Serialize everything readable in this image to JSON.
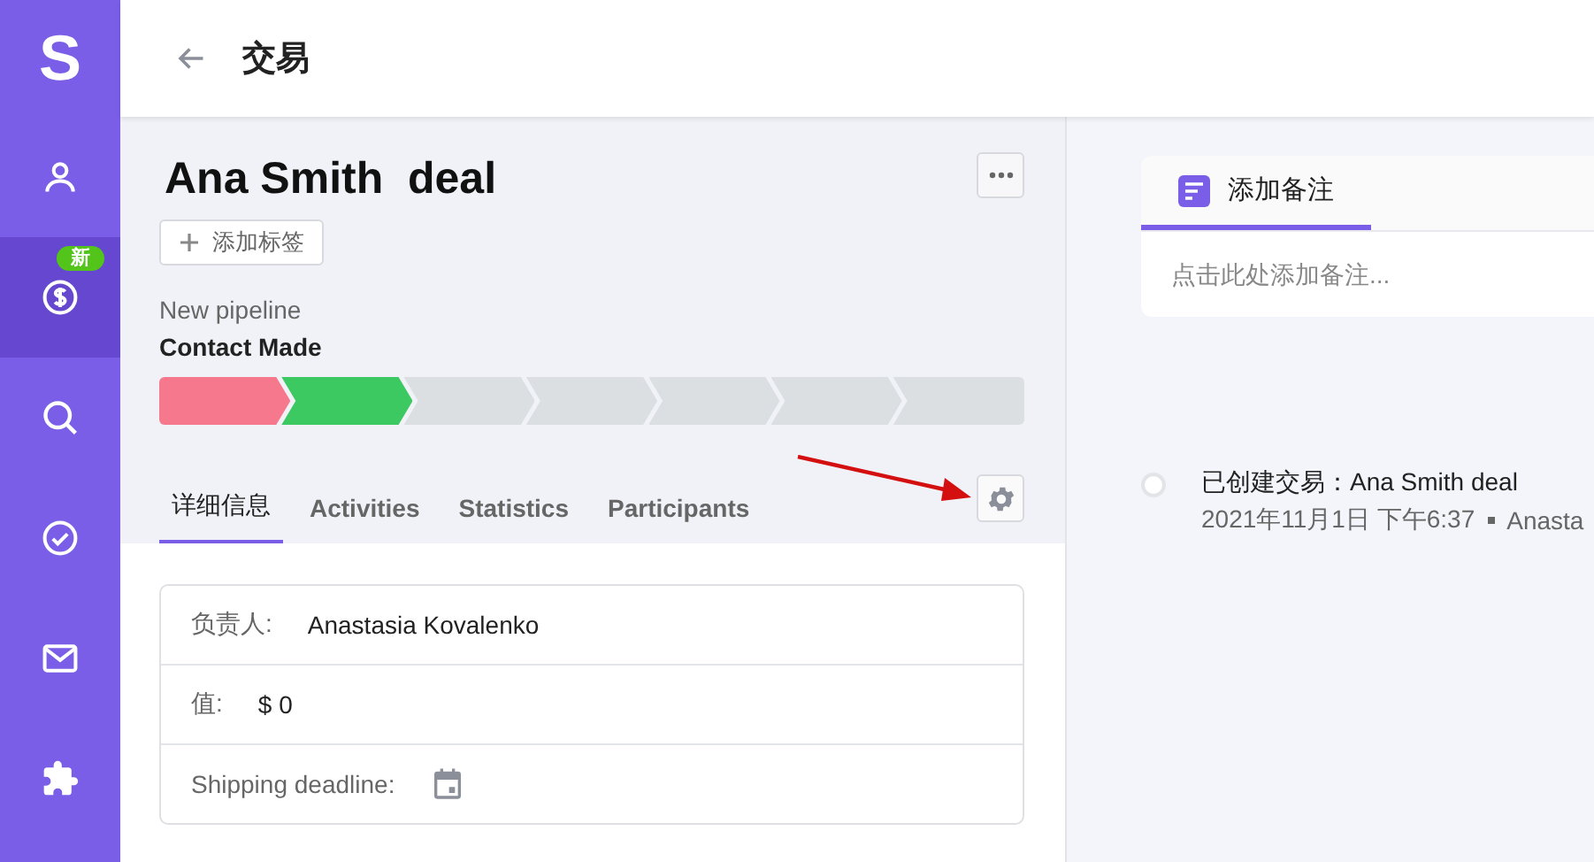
{
  "sidebar": {
    "logo": "S",
    "items": [
      {
        "kind": "person",
        "selected": false
      },
      {
        "kind": "dollar",
        "selected": true,
        "badge": "新"
      },
      {
        "kind": "search",
        "selected": false
      },
      {
        "kind": "check",
        "selected": false
      },
      {
        "kind": "mail",
        "selected": false
      },
      {
        "kind": "puzzle",
        "selected": false
      }
    ]
  },
  "header": {
    "title": "交易"
  },
  "deal": {
    "title": "Ana Smith  deal",
    "add_tag": "添加标签",
    "pipeline": "New pipeline",
    "stage": "Contact Made",
    "stages": [
      {
        "color": "#f5788c"
      },
      {
        "color": "#3cc962"
      },
      {
        "color": "#dcdfe2"
      },
      {
        "color": "#dcdfe2"
      },
      {
        "color": "#dcdfe2"
      },
      {
        "color": "#dcdfe2"
      },
      {
        "color": "#dcdfe2"
      }
    ]
  },
  "tabs": [
    {
      "label": "详细信息",
      "selected": true
    },
    {
      "label": "Activities",
      "selected": false
    },
    {
      "label": "Statistics",
      "selected": false
    },
    {
      "label": "Participants",
      "selected": false
    }
  ],
  "details": [
    {
      "kind": "text",
      "label": "负责人:",
      "value": "Anastasia Kovalenko"
    },
    {
      "kind": "text",
      "label": "值:",
      "value": "$ 0"
    },
    {
      "kind": "date",
      "label": "Shipping deadline:"
    }
  ],
  "note": {
    "tab": "添加备注",
    "placeholder": "点击此处添加备注..."
  },
  "timeline": [
    {
      "title": "已创建交易：Ana Smith deal",
      "meta": "2021年11月1日 下午6:37",
      "author": "Anasta"
    }
  ]
}
